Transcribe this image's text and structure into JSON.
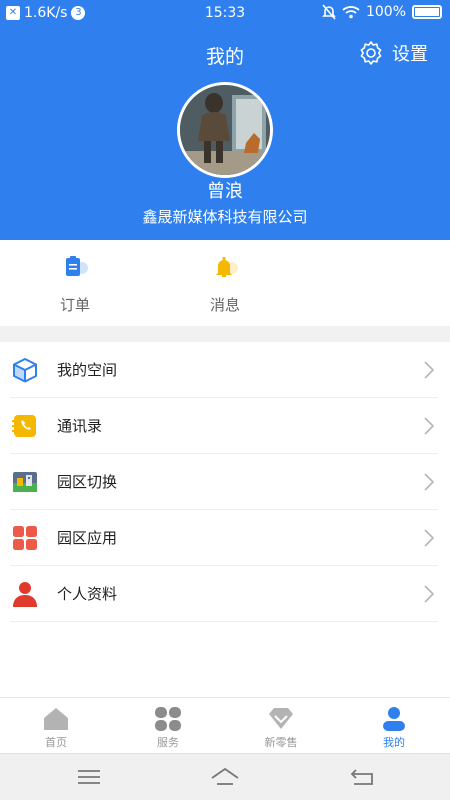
{
  "status_bar": {
    "speed": "1.6K/s",
    "notification_count": "3",
    "time": "15:33",
    "battery": "100%"
  },
  "header": {
    "title": "我的",
    "settings_label": "设置",
    "user_name": "曾浪",
    "company": "鑫晟新媒体科技有限公司",
    "background_color": "#2f80ee"
  },
  "quick_actions": [
    {
      "label": "订单",
      "icon": "clipboard-icon"
    },
    {
      "label": "消息",
      "icon": "bell-icon"
    }
  ],
  "menu": [
    {
      "label": "我的空间",
      "icon": "cube-icon"
    },
    {
      "label": "通讯录",
      "icon": "contacts-phone-icon"
    },
    {
      "label": "园区切换",
      "icon": "park-switch-icon"
    },
    {
      "label": "园区应用",
      "icon": "apps-grid-icon"
    },
    {
      "label": "个人资料",
      "icon": "person-icon"
    }
  ],
  "tabs": [
    {
      "label": "首页",
      "icon": "home-icon",
      "active": false
    },
    {
      "label": "服务",
      "icon": "service-grid-icon",
      "active": false
    },
    {
      "label": "新零售",
      "icon": "diamond-icon",
      "active": false
    },
    {
      "label": "我的",
      "icon": "profile-icon",
      "active": true
    }
  ],
  "colors": {
    "accent": "#2f80ee",
    "inactive_tab": "#999999"
  }
}
